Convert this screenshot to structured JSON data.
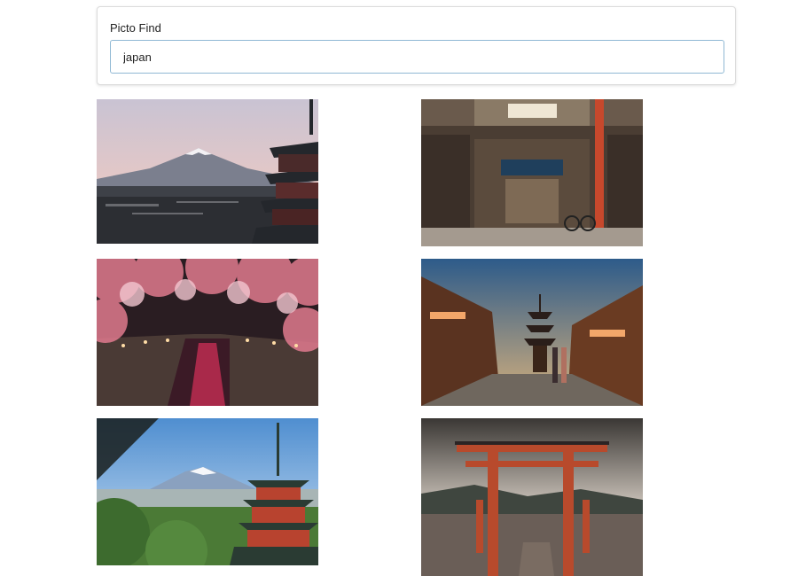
{
  "app": {
    "title": "Picto Find"
  },
  "search": {
    "value": "japan"
  },
  "results": [
    {
      "id": "fuji-pagoda-dusk",
      "description_icon": "mountain-pagoda-image"
    },
    {
      "id": "street-shop",
      "description_icon": "storefront-image"
    },
    {
      "id": "cherry-blossom-canal",
      "description_icon": "cherry-blossom-image"
    },
    {
      "id": "kyoto-street-pagoda",
      "description_icon": "street-pagoda-image"
    },
    {
      "id": "fuji-pagoda-day",
      "description_icon": "mountain-pagoda-image"
    },
    {
      "id": "torii-gate-water",
      "description_icon": "torii-gate-image"
    }
  ]
}
